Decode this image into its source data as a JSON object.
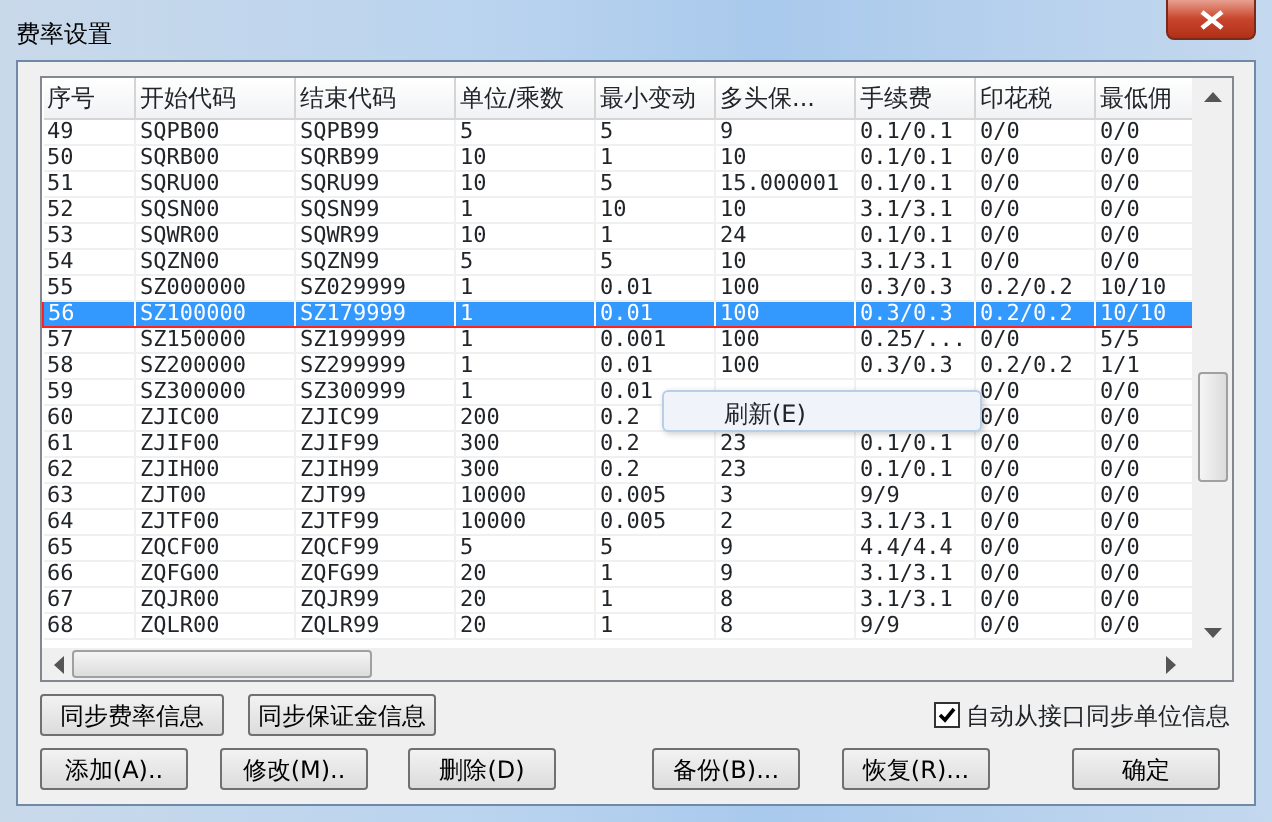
{
  "window": {
    "title": "费率设置"
  },
  "table": {
    "columns": [
      "序号",
      "开始代码",
      "结束代码",
      "单位/乘数",
      "最小变动",
      "多头保...",
      "手续费",
      "印花税",
      "最低佣"
    ],
    "rows": [
      {
        "cells": [
          "49",
          "SQPB00",
          "SQPB99",
          "5",
          "5",
          "9",
          "0.1/0.1",
          "0/0",
          "0/0"
        ],
        "selected": false
      },
      {
        "cells": [
          "50",
          "SQRB00",
          "SQRB99",
          "10",
          "1",
          "10",
          "0.1/0.1",
          "0/0",
          "0/0"
        ],
        "selected": false
      },
      {
        "cells": [
          "51",
          "SQRU00",
          "SQRU99",
          "10",
          "5",
          "15.000001",
          "0.1/0.1",
          "0/0",
          "0/0"
        ],
        "selected": false
      },
      {
        "cells": [
          "52",
          "SQSN00",
          "SQSN99",
          "1",
          "10",
          "10",
          "3.1/3.1",
          "0/0",
          "0/0"
        ],
        "selected": false
      },
      {
        "cells": [
          "53",
          "SQWR00",
          "SQWR99",
          "10",
          "1",
          "24",
          "0.1/0.1",
          "0/0",
          "0/0"
        ],
        "selected": false
      },
      {
        "cells": [
          "54",
          "SQZN00",
          "SQZN99",
          "5",
          "5",
          "10",
          "3.1/3.1",
          "0/0",
          "0/0"
        ],
        "selected": false
      },
      {
        "cells": [
          "55",
          "SZ000000",
          "SZ029999",
          "1",
          "0.01",
          "100",
          "0.3/0.3",
          "0.2/0.2",
          "10/10"
        ],
        "selected": false
      },
      {
        "cells": [
          "56",
          "SZ100000",
          "SZ179999",
          "1",
          "0.01",
          "100",
          "0.3/0.3",
          "0.2/0.2",
          "10/10"
        ],
        "selected": true
      },
      {
        "cells": [
          "57",
          "SZ150000",
          "SZ199999",
          "1",
          "0.001",
          "100",
          "0.25/...",
          "0/0",
          "5/5"
        ],
        "selected": false
      },
      {
        "cells": [
          "58",
          "SZ200000",
          "SZ299999",
          "1",
          "0.01",
          "100",
          "0.3/0.3",
          "0.2/0.2",
          "1/1"
        ],
        "selected": false
      },
      {
        "cells": [
          "59",
          "SZ300000",
          "SZ300999",
          "1",
          "0.01",
          null,
          null,
          "0/0",
          "0/0"
        ],
        "selected": false
      },
      {
        "cells": [
          "60",
          "ZJIC00",
          "ZJIC99",
          "200",
          "0.2",
          null,
          null,
          "0/0",
          "0/0"
        ],
        "selected": false
      },
      {
        "cells": [
          "61",
          "ZJIF00",
          "ZJIF99",
          "300",
          "0.2",
          "23",
          "0.1/0.1",
          "0/0",
          "0/0"
        ],
        "selected": false
      },
      {
        "cells": [
          "62",
          "ZJIH00",
          "ZJIH99",
          "300",
          "0.2",
          "23",
          "0.1/0.1",
          "0/0",
          "0/0"
        ],
        "selected": false
      },
      {
        "cells": [
          "63",
          "ZJT00",
          "ZJT99",
          "10000",
          "0.005",
          "3",
          "9/9",
          "0/0",
          "0/0"
        ],
        "selected": false
      },
      {
        "cells": [
          "64",
          "ZJTF00",
          "ZJTF99",
          "10000",
          "0.005",
          "2",
          "3.1/3.1",
          "0/0",
          "0/0"
        ],
        "selected": false
      },
      {
        "cells": [
          "65",
          "ZQCF00",
          "ZQCF99",
          "5",
          "5",
          "9",
          "4.4/4.4",
          "0/0",
          "0/0"
        ],
        "selected": false
      },
      {
        "cells": [
          "66",
          "ZQFG00",
          "ZQFG99",
          "20",
          "1",
          "9",
          "3.1/3.1",
          "0/0",
          "0/0"
        ],
        "selected": false
      },
      {
        "cells": [
          "67",
          "ZQJR00",
          "ZQJR99",
          "20",
          "1",
          "8",
          "3.1/3.1",
          "0/0",
          "0/0"
        ],
        "selected": false
      },
      {
        "cells": [
          "68",
          "ZQLR00",
          "ZQLR99",
          "20",
          "1",
          "8",
          "9/9",
          "0/0",
          "0/0"
        ],
        "selected": false
      }
    ]
  },
  "context_menu": {
    "items": [
      "刷新(E)"
    ]
  },
  "sync_buttons": [
    "同步费率信息",
    "同步保证金信息"
  ],
  "auto_sync": {
    "label": "自动从接口同步单位信息",
    "checked": true
  },
  "buttons": [
    "添加(A)..",
    "修改(M)..",
    "删除(D)",
    "备份(B)...",
    "恢复(R)...",
    "确定"
  ]
}
